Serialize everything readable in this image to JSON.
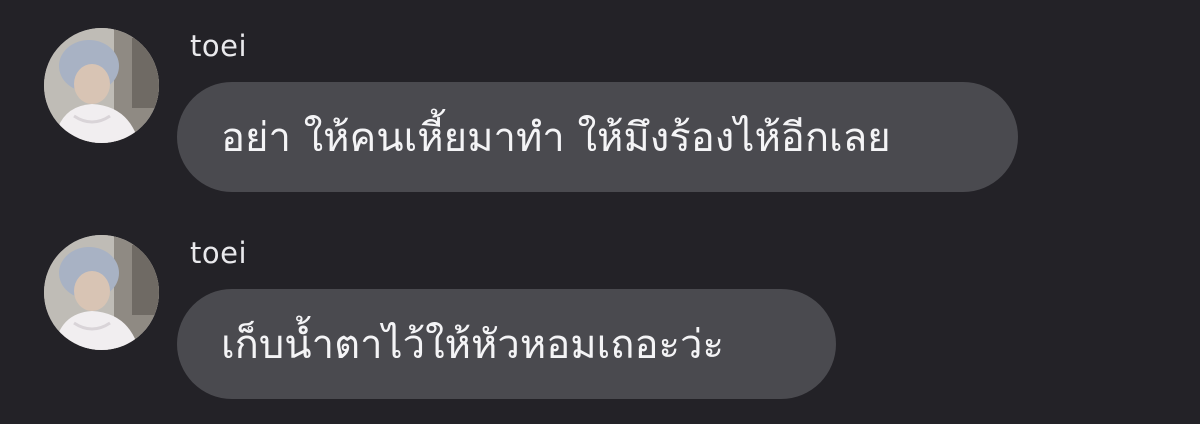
{
  "conversation": {
    "messages": [
      {
        "sender": "toei",
        "text": "อย่า ให้คนเหี้ยมาทำ ให้มึงร้องไห้อีกเลย",
        "avatar_icon": "user-avatar-photo"
      },
      {
        "sender": "toei",
        "text": "เก็บน้ำตาไว้ให้หัวหอมเถอะว่ะ",
        "avatar_icon": "user-avatar-photo"
      }
    ]
  },
  "colors": {
    "background": "#232227",
    "bubble": "#4a4a4f",
    "text": "#f4f4f6",
    "sender_text": "#e9e9ec"
  }
}
